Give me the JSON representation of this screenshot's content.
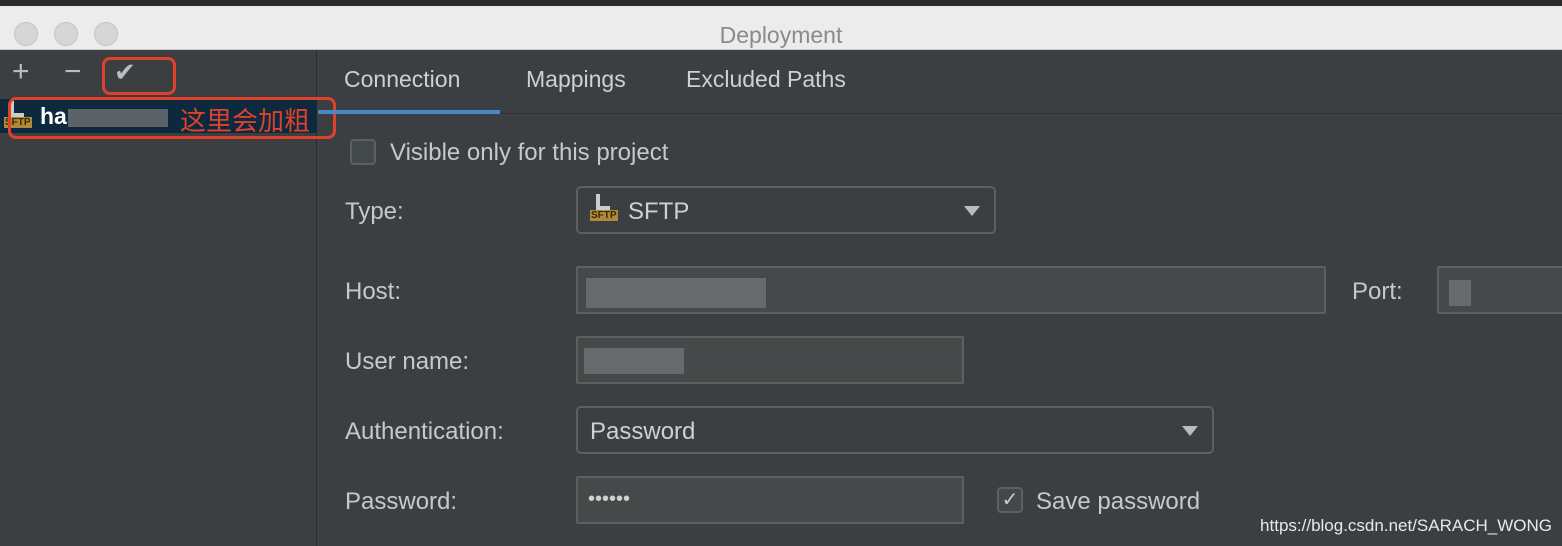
{
  "window": {
    "title": "Deployment"
  },
  "sidebar": {
    "add_icon": "+",
    "remove_icon": "−",
    "default_icon": "✔",
    "server": {
      "name_prefix": "ha",
      "icon": "sftp-icon"
    },
    "annotation": "这里会加粗"
  },
  "tabs": [
    {
      "label": "Connection",
      "active": true
    },
    {
      "label": "Mappings"
    },
    {
      "label": "Excluded Paths"
    }
  ],
  "form": {
    "visible_only": {
      "label": "Visible only for this project",
      "checked": false
    },
    "type": {
      "label": "Type:",
      "value": "SFTP"
    },
    "host": {
      "label": "Host:"
    },
    "port": {
      "label": "Port:"
    },
    "username": {
      "label": "User name:"
    },
    "auth": {
      "label": "Authentication:",
      "value": "Password"
    },
    "password": {
      "label": "Password:",
      "value": "••••••"
    },
    "save_password": {
      "label": "Save password",
      "checked": true,
      "mark": "✓"
    }
  },
  "watermark": "https://blog.csdn.net/SARACH_WONG",
  "colors": {
    "accent": "#4a88c7",
    "annotation": "#e0412c"
  }
}
